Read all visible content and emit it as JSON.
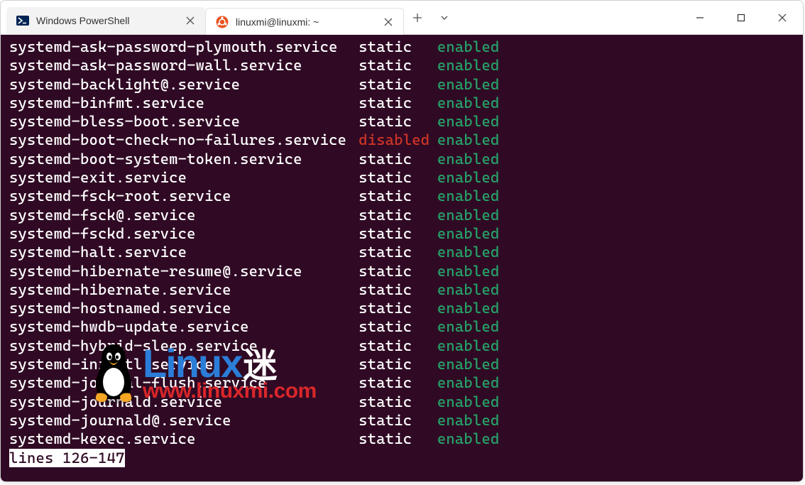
{
  "tabs": [
    {
      "title": "Windows PowerShell",
      "icon": "powershell-icon",
      "active": false
    },
    {
      "title": "linuxmi@linuxmi: ~",
      "icon": "ubuntu-icon",
      "active": true
    }
  ],
  "terminal": {
    "rows": [
      {
        "unit": "systemd-ask-password-plymouth.service",
        "state": "static",
        "state_class": "c-static",
        "vendor": "enabled"
      },
      {
        "unit": "systemd-ask-password-wall.service",
        "state": "static",
        "state_class": "c-static",
        "vendor": "enabled"
      },
      {
        "unit": "systemd-backlight@.service",
        "state": "static",
        "state_class": "c-static",
        "vendor": "enabled"
      },
      {
        "unit": "systemd-binfmt.service",
        "state": "static",
        "state_class": "c-static",
        "vendor": "enabled"
      },
      {
        "unit": "systemd-bless-boot.service",
        "state": "static",
        "state_class": "c-static",
        "vendor": "enabled"
      },
      {
        "unit": "systemd-boot-check-no-failures.service",
        "state": "disabled",
        "state_class": "c-disabled",
        "vendor": "enabled"
      },
      {
        "unit": "systemd-boot-system-token.service",
        "state": "static",
        "state_class": "c-static",
        "vendor": "enabled"
      },
      {
        "unit": "systemd-exit.service",
        "state": "static",
        "state_class": "c-static",
        "vendor": "enabled"
      },
      {
        "unit": "systemd-fsck-root.service",
        "state": "static",
        "state_class": "c-static",
        "vendor": "enabled"
      },
      {
        "unit": "systemd-fsck@.service",
        "state": "static",
        "state_class": "c-static",
        "vendor": "enabled"
      },
      {
        "unit": "systemd-fsckd.service",
        "state": "static",
        "state_class": "c-static",
        "vendor": "enabled"
      },
      {
        "unit": "systemd-halt.service",
        "state": "static",
        "state_class": "c-static",
        "vendor": "enabled"
      },
      {
        "unit": "systemd-hibernate-resume@.service",
        "state": "static",
        "state_class": "c-static",
        "vendor": "enabled"
      },
      {
        "unit": "systemd-hibernate.service",
        "state": "static",
        "state_class": "c-static",
        "vendor": "enabled"
      },
      {
        "unit": "systemd-hostnamed.service",
        "state": "static",
        "state_class": "c-static",
        "vendor": "enabled"
      },
      {
        "unit": "systemd-hwdb-update.service",
        "state": "static",
        "state_class": "c-static",
        "vendor": "enabled"
      },
      {
        "unit": "systemd-hybrid-sleep.service",
        "state": "static",
        "state_class": "c-static",
        "vendor": "enabled"
      },
      {
        "unit": "systemd-initctl.service",
        "state": "static",
        "state_class": "c-static",
        "vendor": "enabled"
      },
      {
        "unit": "systemd-journal-flush.service",
        "state": "static",
        "state_class": "c-static",
        "vendor": "enabled"
      },
      {
        "unit": "systemd-journald.service",
        "state": "static",
        "state_class": "c-static",
        "vendor": "enabled"
      },
      {
        "unit": "systemd-journald@.service",
        "state": "static",
        "state_class": "c-static",
        "vendor": "enabled"
      },
      {
        "unit": "systemd-kexec.service",
        "state": "static",
        "state_class": "c-static",
        "vendor": "enabled"
      }
    ],
    "pager_status": "lines 126-147"
  },
  "watermark": {
    "brand_latin": "Linux",
    "brand_cjk": "迷",
    "url": "www.linuxmi.com"
  },
  "colors": {
    "terminal_bg": "#300a24",
    "enabled": "#26a269",
    "disabled": "#ce3426",
    "accent_blue": "#2b7ed8",
    "accent_red": "#d9262a"
  }
}
